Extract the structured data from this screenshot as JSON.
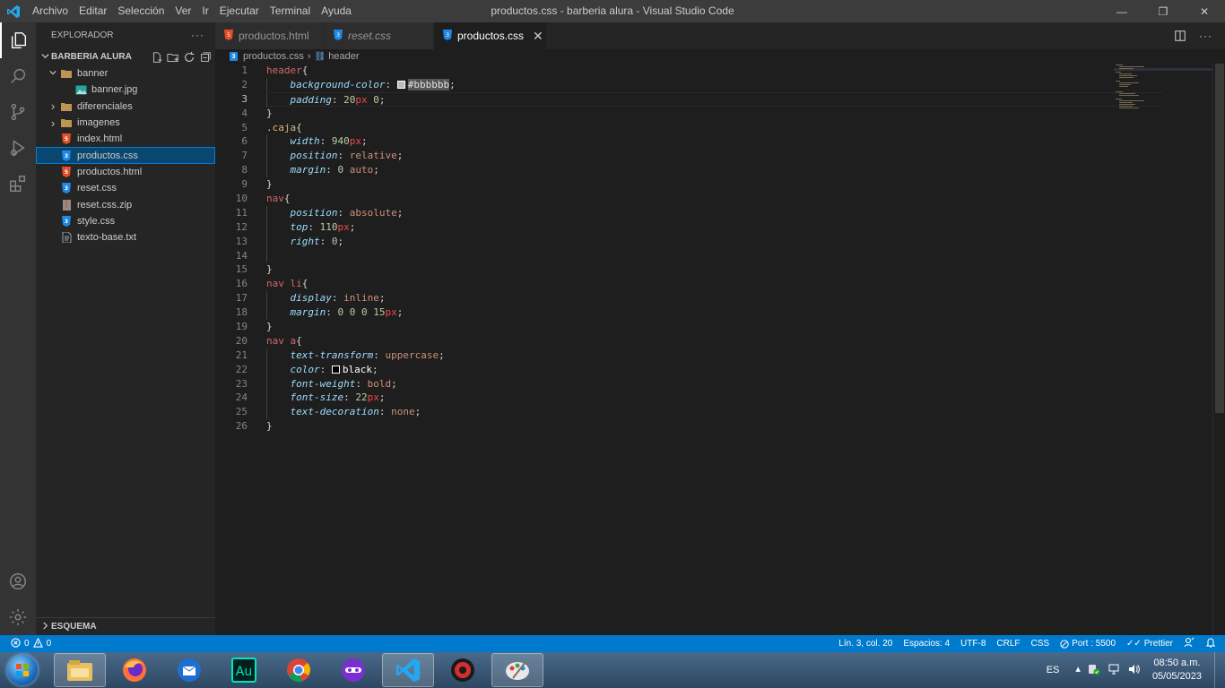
{
  "app": {
    "menu": [
      "Archivo",
      "Editar",
      "Selección",
      "Ver",
      "Ir",
      "Ejecutar",
      "Terminal",
      "Ayuda"
    ],
    "window_title": "productos.css - barberia alura - Visual Studio Code",
    "window_controls": {
      "minimize": "—",
      "maximize": "❐",
      "close": "✕"
    }
  },
  "sidebar": {
    "header": "EXPLORADOR",
    "more": "···",
    "section_title": "BARBERIA ALURA",
    "tree": [
      {
        "label": "banner",
        "type": "folder-open",
        "indent": 1
      },
      {
        "label": "banner.jpg",
        "type": "image",
        "indent": 2
      },
      {
        "label": "diferenciales",
        "type": "folder",
        "indent": 1
      },
      {
        "label": "imagenes",
        "type": "folder",
        "indent": 1
      },
      {
        "label": "index.html",
        "type": "html",
        "indent": 1
      },
      {
        "label": "productos.css",
        "type": "css",
        "indent": 1,
        "selected": true
      },
      {
        "label": "productos.html",
        "type": "html",
        "indent": 1
      },
      {
        "label": "reset.css",
        "type": "css",
        "indent": 1
      },
      {
        "label": "reset.css.zip",
        "type": "zip",
        "indent": 1
      },
      {
        "label": "style.css",
        "type": "css",
        "indent": 1
      },
      {
        "label": "texto-base.txt",
        "type": "txt",
        "indent": 1
      }
    ],
    "outline": "ESQUEMA"
  },
  "tabs": [
    {
      "label": "productos.html",
      "type": "html",
      "active": false
    },
    {
      "label": "reset.css",
      "type": "css",
      "active": false
    },
    {
      "label": "productos.css",
      "type": "css",
      "active": true
    }
  ],
  "tab_close": "✕",
  "breadcrumb": {
    "file": "productos.css",
    "symbol": "header"
  },
  "editor": {
    "current_line": 3,
    "lines": [
      [
        [
          "header",
          "tag"
        ],
        [
          "{",
          "pun"
        ]
      ],
      [
        [
          "    ",
          ""
        ],
        [
          "background-color",
          "prop"
        ],
        [
          ": ",
          "pun"
        ],
        [
          "swatch:#bbbbbb",
          "swatch"
        ],
        [
          "#bbbbbb",
          "hexsel"
        ],
        [
          ";",
          "pun"
        ]
      ],
      [
        [
          "    ",
          ""
        ],
        [
          "padding",
          "prop"
        ],
        [
          ": ",
          "pun"
        ],
        [
          "20",
          "num"
        ],
        [
          "px",
          "unit"
        ],
        [
          " ",
          ""
        ],
        [
          "0",
          "num"
        ],
        [
          ";",
          "pun"
        ]
      ],
      [
        [
          "}",
          "pun"
        ]
      ],
      [
        [
          ".caja",
          "cls"
        ],
        [
          "{",
          "pun"
        ]
      ],
      [
        [
          "    ",
          ""
        ],
        [
          "width",
          "prop"
        ],
        [
          ": ",
          "pun"
        ],
        [
          "940",
          "num"
        ],
        [
          "px",
          "unit"
        ],
        [
          ";",
          "pun"
        ]
      ],
      [
        [
          "    ",
          ""
        ],
        [
          "position",
          "prop"
        ],
        [
          ": ",
          "pun"
        ],
        [
          "relative",
          "val"
        ],
        [
          ";",
          "pun"
        ]
      ],
      [
        [
          "    ",
          ""
        ],
        [
          "margin",
          "prop"
        ],
        [
          ": ",
          "pun"
        ],
        [
          "0",
          "num"
        ],
        [
          " ",
          ""
        ],
        [
          "auto",
          "val"
        ],
        [
          ";",
          "pun"
        ]
      ],
      [
        [
          "}",
          "pun"
        ]
      ],
      [
        [
          "nav",
          "tag"
        ],
        [
          "{",
          "pun"
        ]
      ],
      [
        [
          "    ",
          ""
        ],
        [
          "position",
          "prop"
        ],
        [
          ": ",
          "pun"
        ],
        [
          "absolute",
          "val"
        ],
        [
          ";",
          "pun"
        ]
      ],
      [
        [
          "    ",
          ""
        ],
        [
          "top",
          "prop"
        ],
        [
          ": ",
          "pun"
        ],
        [
          "110",
          "num"
        ],
        [
          "px",
          "unit"
        ],
        [
          ";",
          "pun"
        ]
      ],
      [
        [
          "    ",
          ""
        ],
        [
          "right",
          "prop"
        ],
        [
          ": ",
          "pun"
        ],
        [
          "0",
          "num"
        ],
        [
          ";",
          "pun"
        ]
      ],
      [
        [
          "",
          ""
        ]
      ],
      [
        [
          "}",
          "pun"
        ]
      ],
      [
        [
          "nav",
          "tag"
        ],
        [
          " ",
          ""
        ],
        [
          "li",
          "tag"
        ],
        [
          "{",
          "pun"
        ]
      ],
      [
        [
          "    ",
          ""
        ],
        [
          "display",
          "prop"
        ],
        [
          ": ",
          "pun"
        ],
        [
          "inline",
          "val"
        ],
        [
          ";",
          "pun"
        ]
      ],
      [
        [
          "    ",
          ""
        ],
        [
          "margin",
          "prop"
        ],
        [
          ": ",
          "pun"
        ],
        [
          "0 0 0 ",
          "num"
        ],
        [
          "15",
          "num"
        ],
        [
          "px",
          "unit"
        ],
        [
          ";",
          "pun"
        ]
      ],
      [
        [
          "}",
          "pun"
        ]
      ],
      [
        [
          "nav",
          "tag"
        ],
        [
          " ",
          ""
        ],
        [
          "a",
          "tag"
        ],
        [
          "{",
          "pun"
        ]
      ],
      [
        [
          "    ",
          ""
        ],
        [
          "text-transform",
          "prop"
        ],
        [
          ": ",
          "pun"
        ],
        [
          "uppercase",
          "val"
        ],
        [
          ";",
          "pun"
        ]
      ],
      [
        [
          "    ",
          ""
        ],
        [
          "color",
          "prop"
        ],
        [
          ": ",
          "pun"
        ],
        [
          "swatch:#000000",
          "swatch"
        ],
        [
          "black",
          "plain"
        ],
        [
          ";",
          "pun"
        ]
      ],
      [
        [
          "    ",
          ""
        ],
        [
          "font-weight",
          "prop"
        ],
        [
          ": ",
          "pun"
        ],
        [
          "bold",
          "val"
        ],
        [
          ";",
          "pun"
        ]
      ],
      [
        [
          "    ",
          ""
        ],
        [
          "font-size",
          "prop"
        ],
        [
          ": ",
          "pun"
        ],
        [
          "22",
          "num"
        ],
        [
          "px",
          "unit"
        ],
        [
          ";",
          "pun"
        ]
      ],
      [
        [
          "    ",
          ""
        ],
        [
          "text-decoration",
          "prop"
        ],
        [
          ": ",
          "pun"
        ],
        [
          "none",
          "val"
        ],
        [
          ";",
          "pun"
        ]
      ],
      [
        [
          "}",
          "pun"
        ]
      ]
    ]
  },
  "status": {
    "errors": "0",
    "warnings": "0",
    "position": "Lín. 3, col. 20",
    "spaces": "Espacios: 4",
    "encoding": "UTF-8",
    "eol": "CRLF",
    "language": "CSS",
    "port": "Port : 5500",
    "prettier": "Prettier"
  },
  "taskbar": {
    "apps": [
      "file-explorer",
      "firefox",
      "thunderbird",
      "audition",
      "chrome",
      "incognito",
      "vscode",
      "dragon",
      "paint"
    ],
    "active_app": "vscode",
    "lang": "ES",
    "time": "08:50 a.m.",
    "date": "05/05/2023"
  },
  "colors": {
    "accent": "#007acc",
    "selection": "#094771",
    "tab_active_bg": "#1e1e1e",
    "editor_bg": "#1e1e1e"
  }
}
